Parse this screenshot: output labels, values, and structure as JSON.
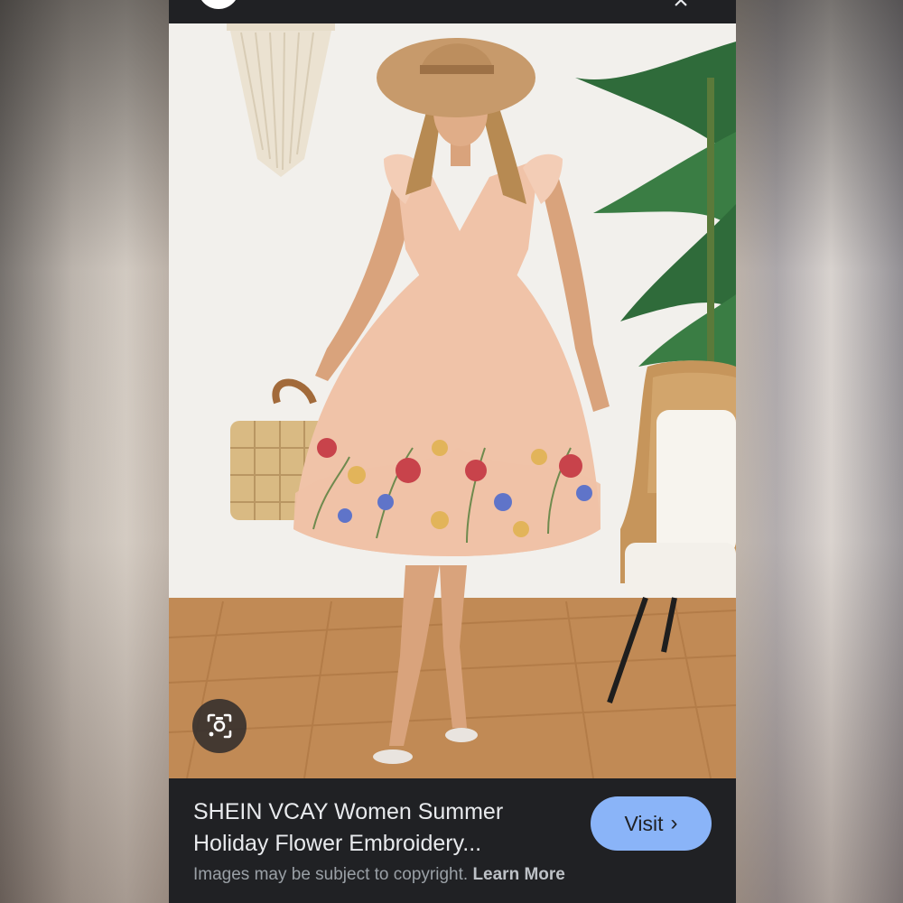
{
  "result": {
    "title_line1": "SHEIN VCAY Women Summer",
    "title_line2": "Holiday Flower Embroidery...",
    "visit_label": "Visit",
    "copyright_text": "Images may be subject to copyright.",
    "learn_more_label": "Learn More"
  },
  "icons": {
    "lens": "google-lens-icon",
    "close": "close-icon",
    "visit_chevron": "chevron-right-icon"
  },
  "colors": {
    "panel_bg": "#202124",
    "visit_button": "#8ab4f8",
    "dress": "#f0c3a8"
  }
}
